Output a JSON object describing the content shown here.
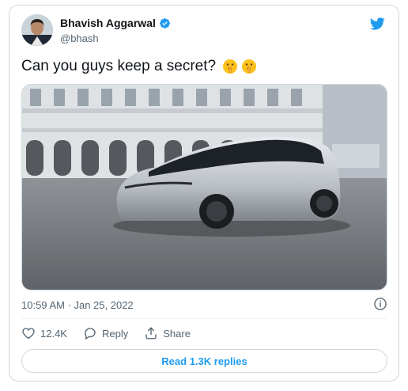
{
  "author": {
    "display_name": "Bhavish Aggarwal",
    "handle": "@bhash",
    "verified": true
  },
  "tweet": {
    "text": "Can you guys keep a secret?",
    "emoji": [
      "shushing-face",
      "shushing-face"
    ],
    "timestamp": "10:59 AM · Jan 25, 2022"
  },
  "actions": {
    "like_count": "12.4K",
    "reply_label": "Reply",
    "share_label": "Share"
  },
  "replies_button": "Read 1.3K replies",
  "colors": {
    "accent": "#1d9bf0",
    "secondary_text": "#536471",
    "border": "#cfd9de"
  },
  "icons": [
    "twitter-bird-icon",
    "verified-badge-icon",
    "info-icon",
    "heart-icon",
    "reply-icon",
    "share-icon"
  ]
}
